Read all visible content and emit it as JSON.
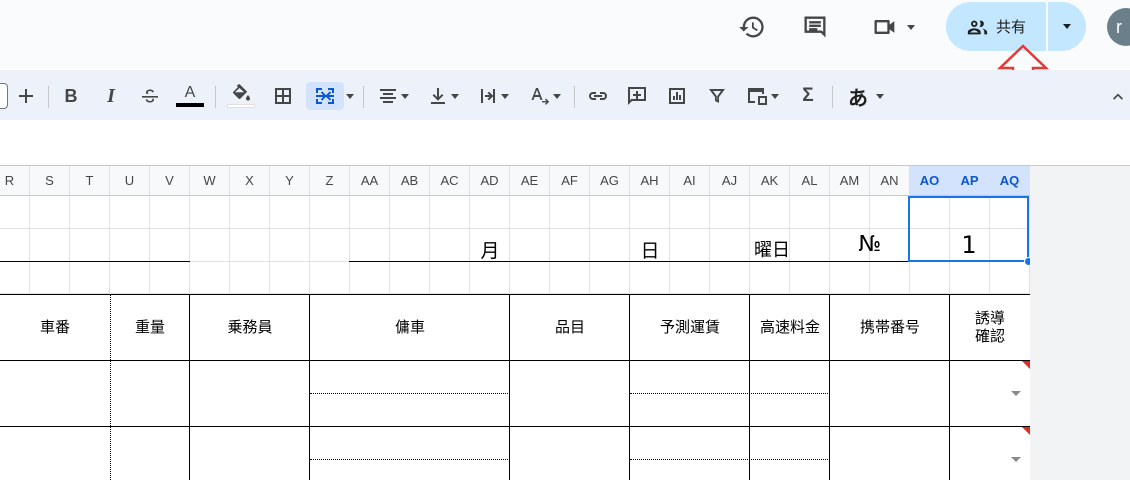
{
  "topbar": {
    "share_label": "共有",
    "avatar_letter": "r"
  },
  "toolbar": {
    "bold": "B",
    "italic": "I",
    "text_color": "A",
    "sum": "Σ",
    "input_tools": "あ"
  },
  "columns": [
    "R",
    "S",
    "T",
    "U",
    "V",
    "W",
    "X",
    "Y",
    "Z",
    "AA",
    "AB",
    "AC",
    "AD",
    "AE",
    "AF",
    "AG",
    "AH",
    "AI",
    "AJ",
    "AK",
    "AL",
    "AM",
    "AN",
    "AO",
    "AP",
    "AQ"
  ],
  "selected_columns": [
    "AO",
    "AP",
    "AQ"
  ],
  "sheet": {
    "date_month": "月",
    "date_day": "日",
    "weekday": "曜日",
    "number_label": "№",
    "number_value": "1",
    "headers": {
      "car_number": "車番",
      "weight": "重量",
      "crew": "乗務員",
      "charter": "傭車",
      "item": "品目",
      "estimated_fare": "予測運賃",
      "highway_fee": "高速料金",
      "mobile_number": "携帯番号",
      "guidance_confirm_1": "誘導",
      "guidance_confirm_2": "確認"
    }
  },
  "colors": {
    "share_bg": "#c2e7ff",
    "toolbar_bg": "#edf2fa",
    "selection": "#1a73e8",
    "annotation_arrow": "#e53935"
  }
}
